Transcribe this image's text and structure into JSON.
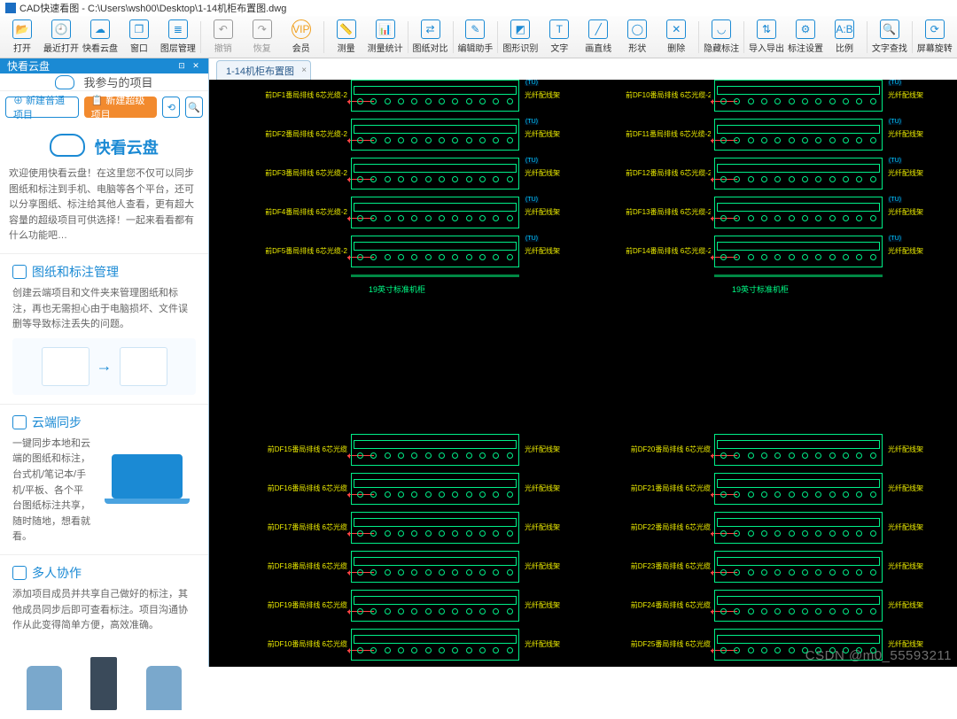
{
  "title": "CAD快速看图 - C:\\Users\\wsh00\\Desktop\\1-14机柜布置图.dwg",
  "toolbar": [
    {
      "label": "打开",
      "glyph": "📂"
    },
    {
      "label": "最近打开",
      "glyph": "🕘"
    },
    {
      "label": "快看云盘",
      "glyph": "☁"
    },
    {
      "label": "窗口",
      "glyph": "❐"
    },
    {
      "label": "图层管理",
      "glyph": "≣"
    },
    {
      "sep": true
    },
    {
      "label": "撤销",
      "glyph": "↶",
      "gray": true
    },
    {
      "label": "恢复",
      "glyph": "↷",
      "gray": true
    },
    {
      "label": "会员",
      "glyph": "VIP",
      "vip": true
    },
    {
      "sep": true
    },
    {
      "label": "测量",
      "glyph": "📏"
    },
    {
      "label": "测量统计",
      "glyph": "📊"
    },
    {
      "sep": true
    },
    {
      "label": "图纸对比",
      "glyph": "⇄"
    },
    {
      "sep": true
    },
    {
      "label": "编辑助手",
      "glyph": "✎"
    },
    {
      "sep": true
    },
    {
      "label": "图形识别",
      "glyph": "◩"
    },
    {
      "label": "文字",
      "glyph": "T"
    },
    {
      "label": "画直线",
      "glyph": "╱"
    },
    {
      "label": "形状",
      "glyph": "◯"
    },
    {
      "label": "删除",
      "glyph": "✕"
    },
    {
      "sep": true
    },
    {
      "label": "隐藏标注",
      "glyph": "◡"
    },
    {
      "sep": true
    },
    {
      "label": "导入导出",
      "glyph": "⇅"
    },
    {
      "label": "标注设置",
      "glyph": "⚙"
    },
    {
      "label": "比例",
      "glyph": "A:B"
    },
    {
      "sep": true
    },
    {
      "label": "文字查找",
      "glyph": "🔍"
    },
    {
      "sep": true
    },
    {
      "label": "屏幕旋转",
      "glyph": "⟳"
    }
  ],
  "sidebar": {
    "panel_title": "快看云盘",
    "tab": "我参与的项目",
    "btn_new_normal": "⊕ 新建普通项目",
    "btn_new_super": "📋 新建超级项目",
    "refresh": "⟲",
    "search": "🔍",
    "brand": "快看云盘",
    "welcome": "欢迎使用快看云盘！在这里您不仅可以同步图纸和标注到手机、电脑等各个平台，还可以分享图纸、标注给其他人查看，更有超大容量的超级项目可供选择！一起来看看都有什么功能吧…",
    "s1_title": "图纸和标注管理",
    "s1_body": "创建云端项目和文件夹来管理图纸和标注，再也无需担心由于电脑损坏、文件误删等导致标注丢失的问题。",
    "s2_title": "云端同步",
    "s2_body": "一键同步本地和云端的图纸和标注，台式机/笔记本/手机/平板、各个平台图纸标注共享，随时随地，想看就看。",
    "s3_title": "多人协作",
    "s3_body": "添加项目成员并共享自己做好的标注，其他成员同步后即可查看标注。项目沟通协作从此变得简单方便，高效准确。"
  },
  "doc_tab": "1-14机柜布置图",
  "watermark": "CSDN @m0_55593211",
  "cabinets": {
    "q1": {
      "prefix": "前DF",
      "range": [
        1,
        2,
        3,
        4,
        5
      ],
      "suffix": "番局排线 6芯光缆-2",
      "right": "光纤配线架",
      "tag": "(TU)",
      "title": "19英寸标准机柜"
    },
    "q2": {
      "prefix": "前DF1",
      "range": [
        0,
        1,
        2,
        3,
        4
      ],
      "suffix": "番局排线 6芯光缆-2",
      "right": "光纤配线架",
      "tag": "(TU)",
      "title": "19英寸标准机柜"
    },
    "q3": {
      "prefix": "前DF1",
      "range": [
        5,
        6,
        7,
        8,
        9,
        0
      ],
      "suffix": "番局排线 6芯光缆",
      "right": "光纤配线架",
      "tag": ""
    },
    "q4": {
      "prefix": "前DF2",
      "range": [
        0,
        1,
        2,
        3,
        4,
        5
      ],
      "suffix": "番局排线 6芯光缆",
      "right": "光纤配线架",
      "tag": ""
    }
  }
}
